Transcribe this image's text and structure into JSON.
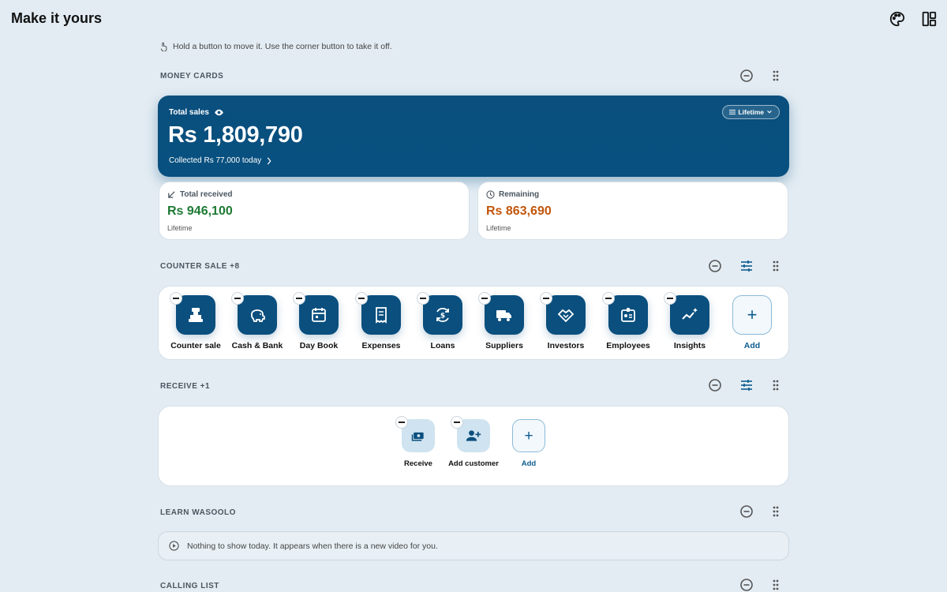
{
  "header": {
    "title": "Make it yours",
    "icons": [
      "palette-icon",
      "layout-icon"
    ]
  },
  "hint": "Hold a button to move it. Use the corner button to take it off.",
  "money_cards": {
    "title": "MONEY CARDS",
    "total": {
      "label": "Total sales",
      "amount": "Rs 1,809,790",
      "collected": "Collected Rs 77,000 today",
      "filter": "Lifetime"
    },
    "received": {
      "label": "Total received",
      "amount": "Rs 946,100",
      "period": "Lifetime",
      "color": "#1d7a33"
    },
    "remaining": {
      "label": "Remaining",
      "amount": "Rs 863,690",
      "period": "Lifetime",
      "color": "#c2560c"
    }
  },
  "counter_sale": {
    "title": "COUNTER SALE +8",
    "tiles": [
      {
        "label": "Counter sale",
        "icon": "cash-register-icon"
      },
      {
        "label": "Cash & Bank",
        "icon": "piggy-bank-icon"
      },
      {
        "label": "Day Book",
        "icon": "calendar-icon"
      },
      {
        "label": "Expenses",
        "icon": "receipt-icon"
      },
      {
        "label": "Loans",
        "icon": "loan-cycle-icon"
      },
      {
        "label": "Suppliers",
        "icon": "truck-icon"
      },
      {
        "label": "Investors",
        "icon": "handshake-icon"
      },
      {
        "label": "Employees",
        "icon": "id-badge-icon"
      },
      {
        "label": "Insights",
        "icon": "sparkle-chart-icon"
      }
    ],
    "add_label": "Add"
  },
  "receive": {
    "title": "RECEIVE +1",
    "tiles": [
      {
        "label": "Receive",
        "icon": "money-receive-icon"
      },
      {
        "label": "Add customer",
        "icon": "person-add-icon"
      }
    ],
    "add_label": "Add"
  },
  "learn": {
    "title": "LEARN WASOOLO",
    "empty_text": "Nothing to show today. It appears when there is a new video for you."
  },
  "calling_list": {
    "title": "CALLING LIST"
  },
  "colors": {
    "accent": "#0a4f7e",
    "background": "#e3ecf3"
  }
}
